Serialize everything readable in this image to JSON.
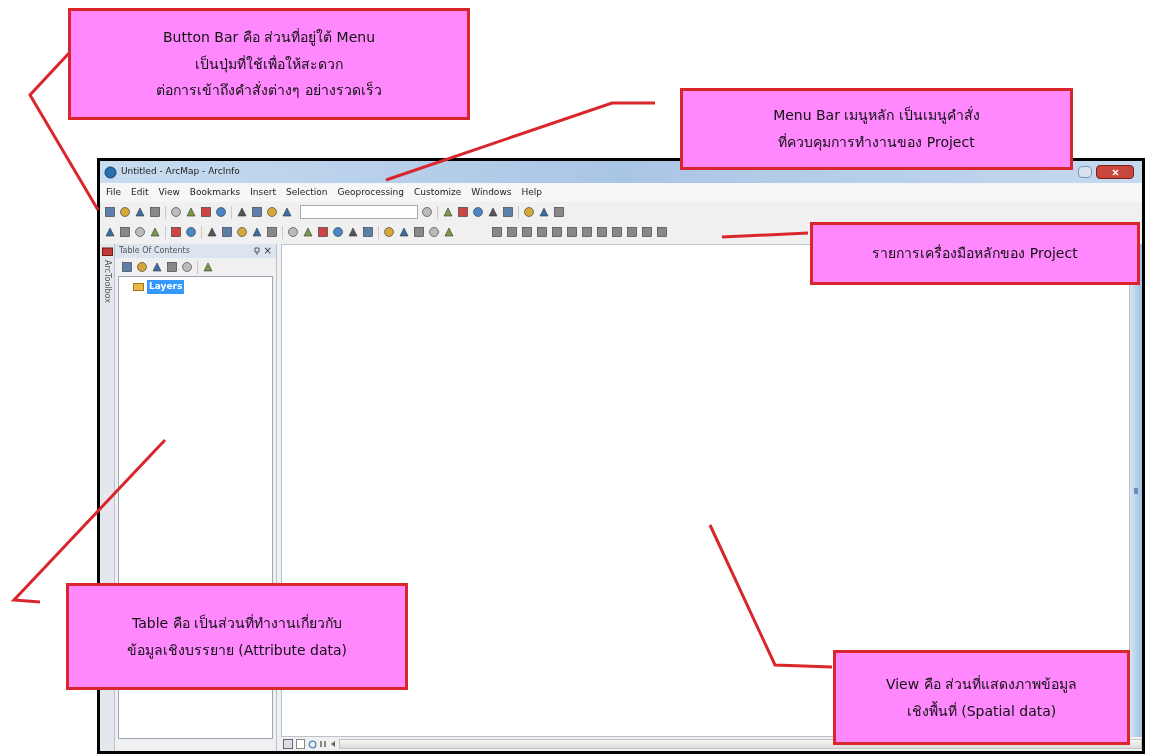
{
  "window": {
    "title": "Untitled - ArcMap - ArcInfo"
  },
  "menu_bar": [
    "File",
    "Edit",
    "View",
    "Bookmarks",
    "Insert",
    "Selection",
    "Geoprocessing",
    "Customize",
    "Windows",
    "Help"
  ],
  "toc": {
    "title": "Table Of Contents",
    "close": "×",
    "side_tab": "ArcToolbox",
    "layers": {
      "label": "Layers",
      "selected": true
    }
  },
  "callouts": [
    {
      "kind": "button_bar",
      "lines": [
        "Button Bar คือ ส่วนที่อยู่ใต้ Menu",
        "เป็นปุ่มที่ใช้เพื่อให้สะดวก",
        "ต่อการเข้าถึงคำสั่งต่างๆ  อย่างรวดเร็ว"
      ]
    },
    {
      "kind": "menu_bar",
      "lines": [
        "Menu Bar เมนูหลัก เป็นเมนูคำสั่ง",
        "ที่ควบคุมการทำงานของ  Project"
      ]
    },
    {
      "kind": "tools",
      "lines": [
        "รายการเครื่องมือหลักของ  Project"
      ]
    },
    {
      "kind": "table",
      "lines": [
        "Table คือ เป็นส่วนที่ทำงานเกี่ยวกับ",
        "ข้อมูลเชิงบรรยาย (Attribute data)"
      ]
    },
    {
      "kind": "view",
      "lines": [
        "View คือ ส่วนที่แสดงภาพข้อมูล",
        "เชิงพื้นที่ (Spatial data)"
      ]
    }
  ]
}
